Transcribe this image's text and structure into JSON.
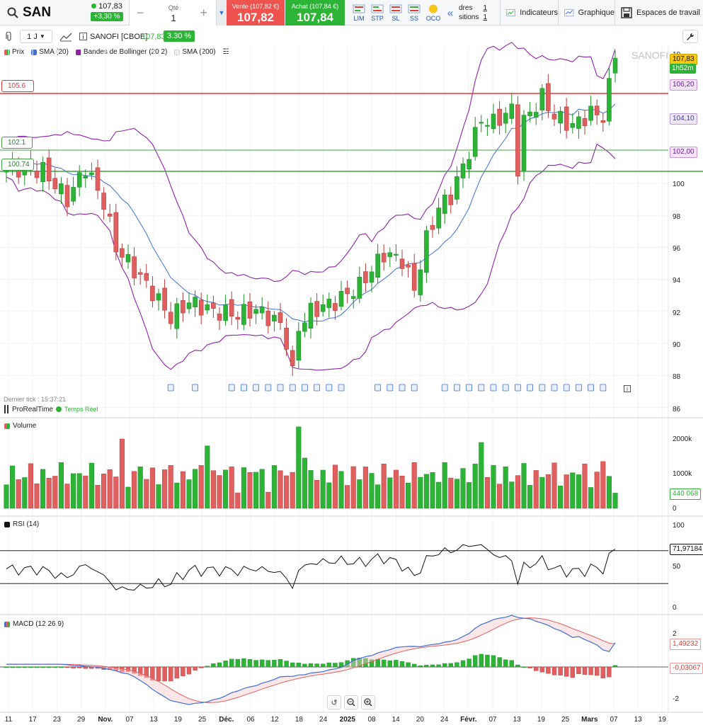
{
  "toolbar": {
    "symbol": "SAN",
    "last_price": "107,83",
    "last_change": "+3,30 %",
    "qty_label": "Qté",
    "qty_value": "1",
    "qty_minus": "−",
    "qty_plus": "+",
    "sell_label": "Vente (107,82 €)",
    "sell_price": "107,82",
    "buy_label": "Achat (107,84 €)",
    "buy_price": "107,84",
    "order_types": [
      "LIM",
      "STP",
      "SL",
      "SS",
      "OCO"
    ],
    "oco_badge": "0.0",
    "orders_label": "dres",
    "orders_count": "1",
    "positions_label": "sitions",
    "positions_count": "1",
    "indicators": "Indicateurs",
    "graph": "Graphique",
    "workspaces": "Espaces de travail"
  },
  "bar2": {
    "timeframe": "1 J",
    "instrument": "SANOFI [CBOE]",
    "price": "107,83",
    "change": "3.30 %"
  },
  "legend": [
    {
      "label": "Prix",
      "color": "#2db336"
    },
    {
      "label": "SMA (20)",
      "color": "#3f6fd6"
    },
    {
      "label": "Bandes de Bollinger (20 2)",
      "color": "#8e24aa"
    },
    {
      "label": "SMA (200)",
      "color": "#e0e0e0"
    }
  ],
  "price_pane": {
    "watermark": "SANOFI",
    "y_ticks": [
      "86",
      "88",
      "90",
      "92",
      "94",
      "96",
      "98",
      "100"
    ],
    "y_top_partial": "10",
    "tag_last": "107,83",
    "tag_countdown": "1h52m",
    "tag_upper_band": "106,20",
    "tag_sma": "104,10",
    "tag_lower_band": "102,00",
    "lines": [
      "105.6",
      "102.1",
      "100.74"
    ],
    "last_tick": "Dernier tick : 15:37:21",
    "provider": "ProRealTime",
    "realtime": "Temps Réel"
  },
  "volume_pane": {
    "title": "Volume",
    "y_ticks": [
      "2000k",
      "1000k",
      "0"
    ],
    "tag": "440 068"
  },
  "rsi_pane": {
    "title": "RSI (14)",
    "y_ticks": [
      "100",
      "50",
      "0"
    ],
    "tag": "71,97184"
  },
  "macd_pane": {
    "title": "MACD (12 26 9)",
    "y_ticks": [
      "2",
      "-2"
    ],
    "tag_macd": "1,49232",
    "tag_hist": "-0,03067"
  },
  "x_axis": [
    "11",
    "17",
    "23",
    "29",
    "Nov.",
    "07",
    "13",
    "19",
    "25",
    "Déc.",
    "06",
    "12",
    "18",
    "24",
    "2025",
    "08",
    "14",
    "20",
    "24",
    "Févr.",
    "07",
    "13",
    "19",
    "25",
    "Mars",
    "07",
    "13",
    "19"
  ],
  "colors": {
    "up": "#2db336",
    "down": "#e06060",
    "sma": "#3f6fd6",
    "bollinger": "#8e24aa",
    "hline_red": "#e53935",
    "hline_green": "#43a047"
  }
}
